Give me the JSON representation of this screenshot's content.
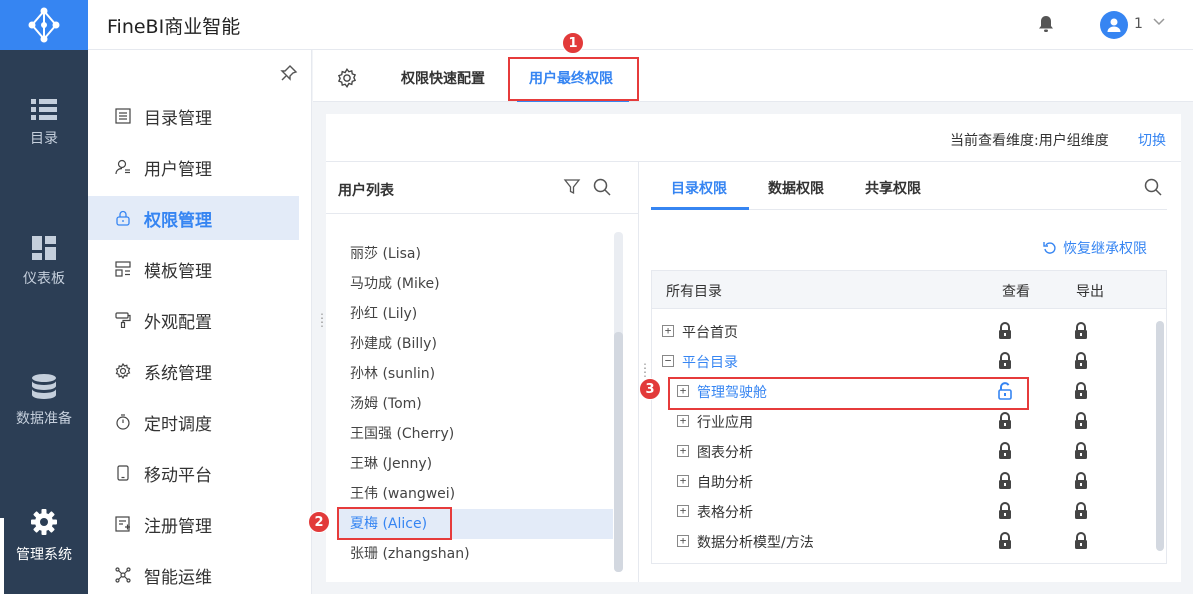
{
  "app": {
    "title": "FineBI商业智能",
    "user": "1"
  },
  "left_nav": [
    {
      "label": "目录",
      "icon": "list-icon"
    },
    {
      "label": "仪表板",
      "icon": "dashboard-icon"
    },
    {
      "label": "数据准备",
      "icon": "database-icon"
    },
    {
      "label": "管理系统",
      "icon": "gear-icon",
      "active": true
    }
  ],
  "sub_nav": [
    {
      "label": "目录管理",
      "icon": "catalog-icon"
    },
    {
      "label": "用户管理",
      "icon": "user-icon"
    },
    {
      "label": "权限管理",
      "icon": "lock-icon",
      "active": true
    },
    {
      "label": "模板管理",
      "icon": "template-icon"
    },
    {
      "label": "外观配置",
      "icon": "brush-icon"
    },
    {
      "label": "系统管理",
      "icon": "gear-icon"
    },
    {
      "label": "定时调度",
      "icon": "timer-icon"
    },
    {
      "label": "移动平台",
      "icon": "mobile-icon"
    },
    {
      "label": "注册管理",
      "icon": "register-icon"
    },
    {
      "label": "智能运维",
      "icon": "ops-icon"
    }
  ],
  "tabs": {
    "quick": "权限快速配置",
    "final": "用户最终权限"
  },
  "dimension": {
    "text": "当前查看维度:用户组维度",
    "switch": "切换"
  },
  "user_list": {
    "title": "用户列表",
    "users": [
      "丽莎 (Lisa)",
      "马功成 (Mike)",
      "孙红 (Lily)",
      "孙建成 (Billy)",
      "孙林 (sunlin)",
      "汤姆 (Tom)",
      "王国强 (Cherry)",
      "王琳 (Jenny)",
      "王伟 (wangwei)",
      "夏梅 (Alice)",
      "张珊 (zhangshan)"
    ],
    "selected": "夏梅 (Alice)"
  },
  "perm_tabs": [
    "目录权限",
    "数据权限",
    "共享权限"
  ],
  "restore": "恢复继承权限",
  "tree": {
    "headers": [
      "所有目录",
      "查看",
      "导出"
    ],
    "rows": [
      {
        "label": "平台首页",
        "toggle": "+"
      },
      {
        "label": "平台目录",
        "toggle": "−"
      },
      {
        "label": "管理驾驶舱",
        "toggle": "+"
      },
      {
        "label": "行业应用",
        "toggle": "+"
      },
      {
        "label": "图表分析",
        "toggle": "+"
      },
      {
        "label": "自助分析",
        "toggle": "+"
      },
      {
        "label": "表格分析",
        "toggle": "+"
      },
      {
        "label": "数据分析模型/方法",
        "toggle": "+"
      }
    ]
  },
  "annotations": [
    "1",
    "2",
    "3"
  ],
  "colors": {
    "accent": "#3685f2",
    "nav_bg": "#2c3e55",
    "annotation": "#e63b3b"
  }
}
